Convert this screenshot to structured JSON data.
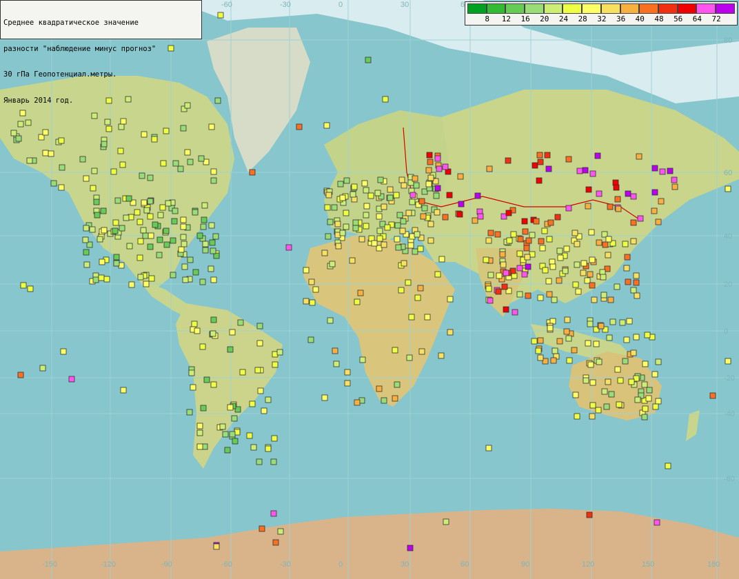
{
  "title": {
    "lines": [
      "Среднее квадратическое значение",
      "разности \"наблюдение минус прогноз\"",
      "30 гПа Геопотенциал.метры.",
      "Январь 2014 год."
    ]
  },
  "legend": {
    "colors": [
      "#00a020",
      "#33bb33",
      "#66cc55",
      "#99dd77",
      "#ccee77",
      "#eeff44",
      "#ffff66",
      "#f8e060",
      "#f8b040",
      "#f87020",
      "#f03010",
      "#f00000",
      "#ff55ee",
      "#bb00ee",
      "#8a0a7a"
    ],
    "labels": [
      "8",
      "12",
      "16",
      "20",
      "24",
      "28",
      "32",
      "36",
      "40",
      "48",
      "56",
      "64",
      "72"
    ]
  },
  "map_axes": {
    "lon_labels": [
      "-150",
      "-120",
      "-90",
      "-60",
      "-30",
      "0",
      "30",
      "60",
      "90",
      "120",
      "150",
      "180"
    ],
    "lat_labels": [
      "80",
      "60",
      "40",
      "20",
      "0",
      "-20",
      "-40",
      "-60"
    ]
  },
  "stations_legend_note": ""
}
